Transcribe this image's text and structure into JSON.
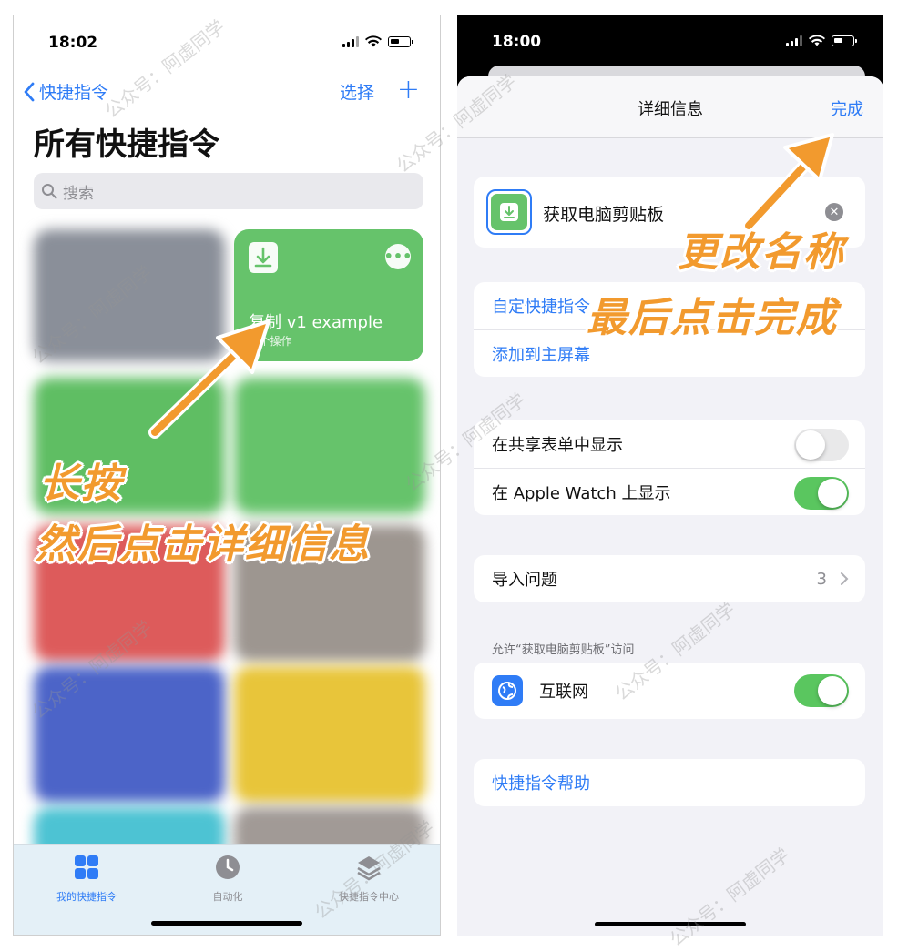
{
  "left": {
    "status": {
      "time": "18:02"
    },
    "nav": {
      "back_label": "快捷指令",
      "select_label": "选择",
      "add_label": "+"
    },
    "title": "所有快捷指令",
    "search_placeholder": "搜索",
    "active_card": {
      "name": "复制 v1 example",
      "subtitle": "3 个操作",
      "more": "•••"
    },
    "tabs": [
      "我的快捷指令",
      "自动化",
      "快捷指令中心"
    ],
    "annotation_line1": "长按",
    "annotation_line2": "然后点击详细信息"
  },
  "right": {
    "status": {
      "time": "18:00"
    },
    "header_title": "详细信息",
    "done_label": "完成",
    "shortcut_name": "获取电脑剪贴板",
    "actions": [
      "自定快捷指令",
      "添加到主屏幕"
    ],
    "toggles": [
      {
        "label": "在共享表单中显示",
        "on": false
      },
      {
        "label": "在 Apple Watch 上显示",
        "on": true
      }
    ],
    "import_questions": {
      "label": "导入问题",
      "value": "3"
    },
    "permission_header": "允许“获取电脑剪贴板”访问",
    "permission": {
      "label": "互联网",
      "on": true
    },
    "help_label": "快捷指令帮助",
    "annotation_line1": "更改名称",
    "annotation_line2": "最后点击完成"
  },
  "watermark": "公众号：阿虚同学",
  "colors": {
    "accent": "#2f7cf6",
    "green": "#5ac65f",
    "annotation": "#f29a2e"
  }
}
